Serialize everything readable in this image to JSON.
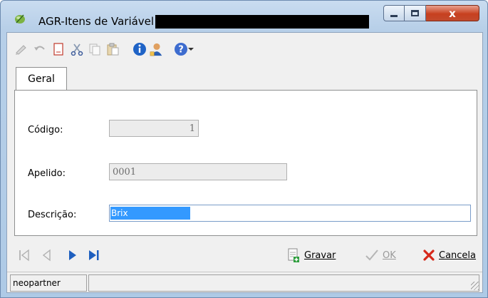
{
  "window": {
    "title": "AGR-Itens de Variável",
    "close_label": "x"
  },
  "toolbar": {
    "icons": [
      "edit-icon",
      "undo-icon",
      "new-document-icon",
      "cut-icon",
      "copy-icon",
      "paste-icon",
      "info-icon",
      "user-icon",
      "help-icon",
      "dropdown-arrow-icon"
    ]
  },
  "tabs": [
    {
      "label": "Geral",
      "active": true
    }
  ],
  "form": {
    "codigo": {
      "label": "Código:",
      "value": "1"
    },
    "apelido": {
      "label": "Apelido:",
      "value": "0001"
    },
    "descricao": {
      "label": "Descrição:",
      "value": "Brix"
    }
  },
  "actions": {
    "save": {
      "label": "Gravar"
    },
    "ok": {
      "label": "OK"
    },
    "cancel": {
      "label": "Cancela"
    }
  },
  "status": {
    "user": "neopartner"
  },
  "colors": {
    "selection": "#3399ff",
    "close_button": "#c7401f",
    "nav_blue": "#1e5fbf"
  }
}
